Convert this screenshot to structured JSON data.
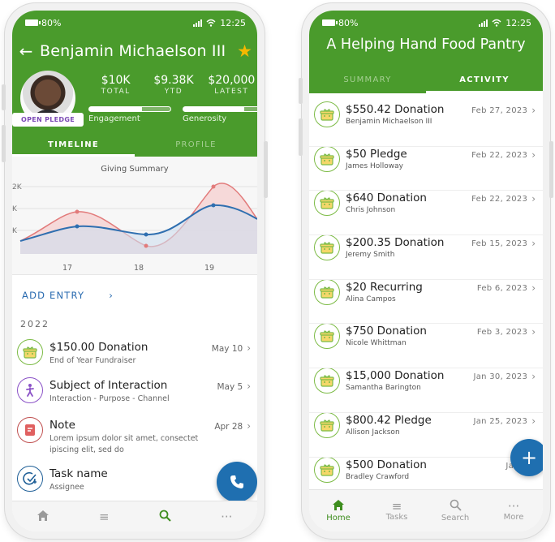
{
  "left_phone": {
    "status": {
      "battery": "80%",
      "time": "12:25"
    },
    "header": {
      "title": "Benjamin Michaelson III"
    },
    "badge": "OPEN PLEDGE",
    "stats": [
      {
        "value": "$10K",
        "label": "TOTAL"
      },
      {
        "value": "$9.38K",
        "label": "YTD"
      },
      {
        "value": "$20,000",
        "label": "LATEST"
      }
    ],
    "meters": [
      {
        "label": "Engagement",
        "level": 0.35
      },
      {
        "label": "Generosity",
        "level": 0.25
      }
    ],
    "tabs": [
      "TIMELINE",
      "PROFILE"
    ],
    "chart_data": {
      "type": "line",
      "title": "Giving Summary",
      "x_ticks": [
        "17",
        "18",
        "19"
      ],
      "y_ticks": [
        "2K",
        "K",
        "K"
      ],
      "series": [
        {
          "color": "#e27b7b",
          "fill": "#f5cfcf"
        },
        {
          "color": "#2f6fb0",
          "fill": "#cfdeee"
        }
      ]
    },
    "add_entry": "ADD ENTRY",
    "year": "2022",
    "items": [
      {
        "title": "$150.00 Donation",
        "subtitle": "End of Year Fundraiser",
        "date": "May 10",
        "icon": "gift-icon"
      },
      {
        "title": "Subject of Interaction",
        "subtitle": "Interaction - Purpose - Channel",
        "date": "May 5",
        "icon": "person-walk-icon"
      },
      {
        "title": "Note",
        "subtitle": "Lorem ipsum dolor sit amet, consectet ipiscing elit, sed do",
        "date": "Apr 28",
        "icon": "note-icon"
      },
      {
        "title": "Task name",
        "subtitle": "Assignee",
        "date": "",
        "icon": "task-check-icon"
      }
    ],
    "nav": [
      {
        "icon": "home-icon",
        "label": ""
      },
      {
        "icon": "list-icon",
        "label": ""
      },
      {
        "icon": "search-icon",
        "label": ""
      },
      {
        "icon": "more-icon",
        "label": ""
      }
    ]
  },
  "right_phone": {
    "status": {
      "battery": "80%",
      "time": "12:25"
    },
    "header": {
      "title": "A Helping Hand Food Pantry"
    },
    "tabs": [
      "SUMMARY",
      "ACTIVITY"
    ],
    "items": [
      {
        "title": "$550.42 Donation",
        "subtitle": "Benjamin Michaelson III",
        "date": "Feb 27, 2023"
      },
      {
        "title": "$50 Pledge",
        "subtitle": "James Holloway",
        "date": "Feb 22, 2023"
      },
      {
        "title": "$640 Donation",
        "subtitle": "Chris Johnson",
        "date": "Feb 22, 2023"
      },
      {
        "title": "$200.35 Donation",
        "subtitle": "Jeremy Smith",
        "date": "Feb 15, 2023"
      },
      {
        "title": "$20 Recurring",
        "subtitle": "Alina Campos",
        "date": "Feb 6, 2023"
      },
      {
        "title": "$750 Donation",
        "subtitle": "Nicole Whittman",
        "date": "Feb 3, 2023"
      },
      {
        "title": "$15,000 Donation",
        "subtitle": "Samantha Barington",
        "date": "Jan 30, 2023"
      },
      {
        "title": "$800.42 Pledge",
        "subtitle": "Allison Jackson",
        "date": "Jan 25, 2023"
      },
      {
        "title": "$500 Donation",
        "subtitle": "Bradley Crawford",
        "date": "Jan 16,"
      }
    ],
    "nav": [
      {
        "icon": "home-icon",
        "label": "Home"
      },
      {
        "icon": "list-icon",
        "label": "Tasks"
      },
      {
        "icon": "search-icon",
        "label": "Search"
      },
      {
        "icon": "more-icon",
        "label": "More"
      }
    ]
  }
}
